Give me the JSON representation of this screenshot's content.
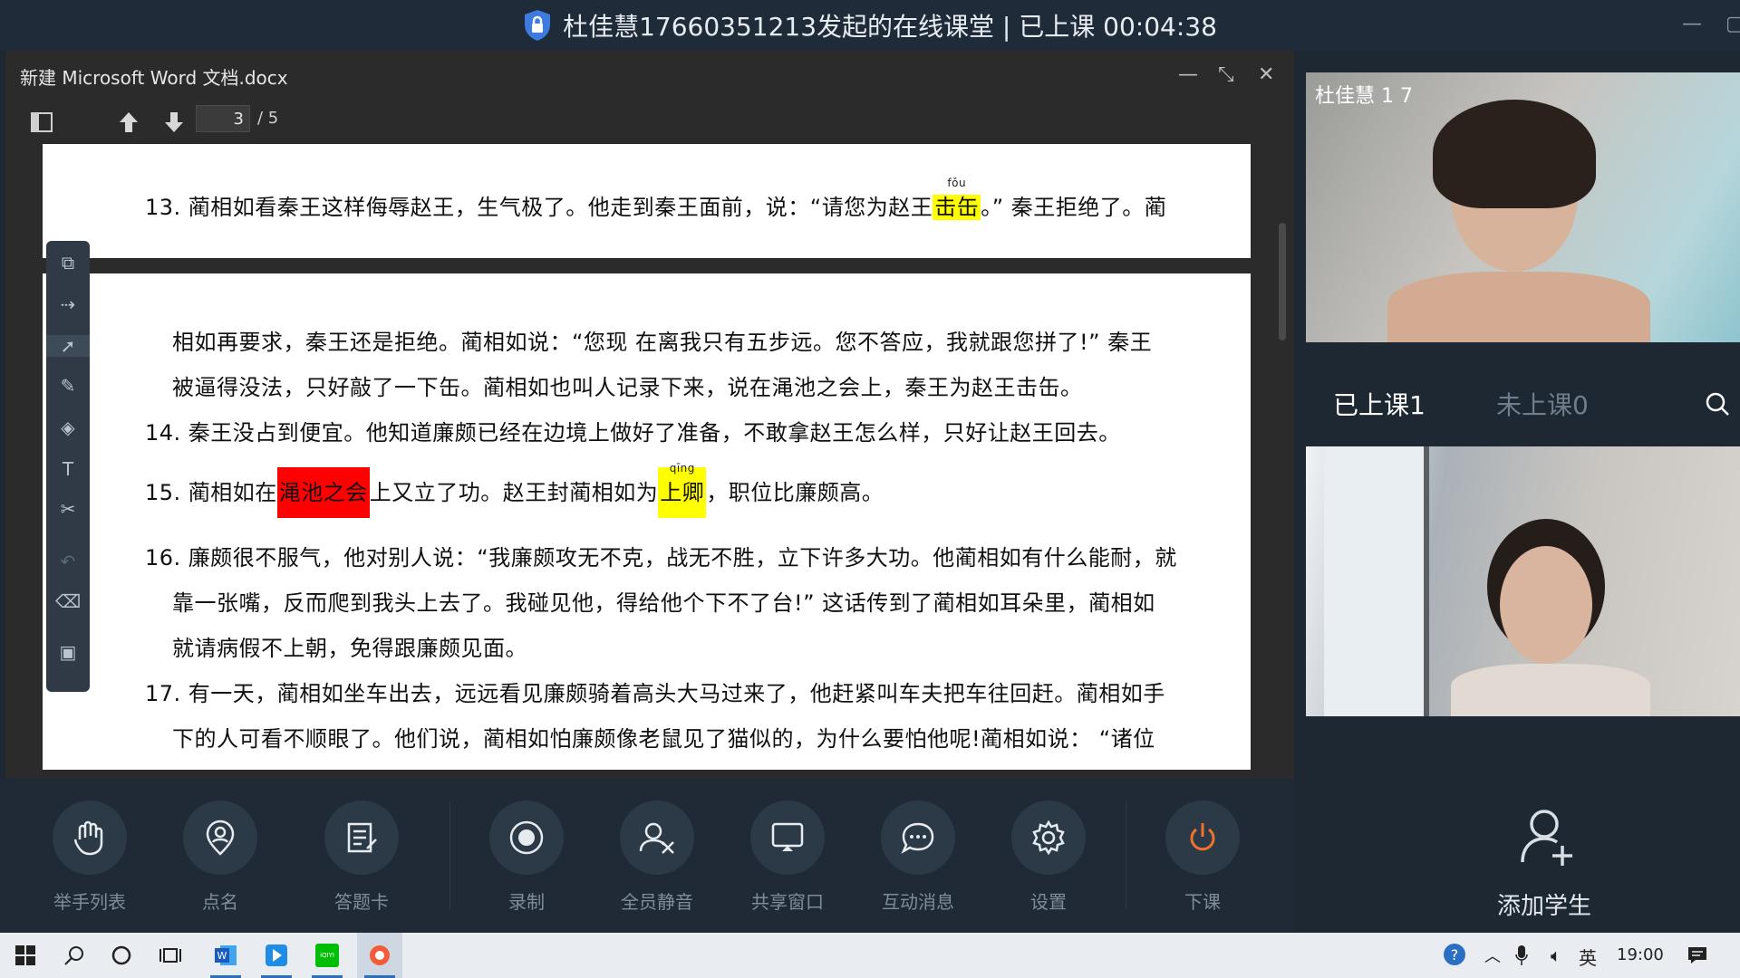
{
  "window": {
    "title": "杜佳慧17660351213发起的在线课堂 | 已上课 00:04:38"
  },
  "document": {
    "title": "新建 Microsoft Word 文档.docx",
    "page_current": "3",
    "page_total": "/ 5",
    "paragraphs": {
      "p13_line1": "13.  蔺相如看秦王这样侮辱赵王，生气极了。他走到秦王面前，说：“请您为赵王",
      "p13_hl": "击缶",
      "p13_ruby": "fǒu",
      "p13_tail": "。”  秦王拒绝了。蔺",
      "p13_line2": "相如再要求，秦王还是拒绝。蔺相如说：“您现  在离我只有五步远。您不答应，我就跟您拼了!”  秦王",
      "p13_line3": "被逼得没法，只好敲了一下缶。蔺相如也叫人记录下来，说在渑池之会上，秦王为赵王击缶。",
      "p14": "14.  秦王没占到便宜。他知道廉颇已经在边境上做好了准备，不敢拿赵王怎么样，只好让赵王回去。",
      "p15_pre": "15.  蔺相如在",
      "p15_red": "渑池之会",
      "p15_mid": "上又立了功。赵王封蔺相如为",
      "p15_hl": "上卿",
      "p15_ruby": "qīng",
      "p15_tail": "，职位比廉颇高。",
      "p16_line1": "16.  廉颇很不服气，他对别人说：“我廉颇攻无不克，战无不胜，立下许多大功。他蔺相如有什么能耐，就",
      "p16_line2": "靠一张嘴，反而爬到我头上去了。我碰见他，得给他个下不了台!”  这话传到了蔺相如耳朵里，蔺相如",
      "p16_line3": "就请病假不上朝，免得跟廉颇见面。",
      "p17_line1": "17.  有一天，蔺相如坐车出去，远远看见廉颇骑着高头大马过来了，他赶紧叫车夫把车往回赶。蔺相如手",
      "p17_line2": "下的人可看不顺眼了。他们说，蔺相如怕廉颇像老鼠见了猫似的，为什么要怕他呢!蔺相如说：  “诸位"
    }
  },
  "participants": {
    "teacher_name": "杜佳慧 1 7",
    "tab_attended": "已上课1",
    "tab_absent": "未上课0",
    "add_student": "添加学生"
  },
  "toolbar": {
    "raise_hand": "举手列表",
    "roll_call": "点名",
    "answer_card": "答题卡",
    "record": "录制",
    "mute_all": "全员静音",
    "share_window": "共享窗口",
    "messages": "互动消息",
    "settings": "设置",
    "end_class": "下课"
  },
  "taskbar": {
    "input_lang": "英",
    "time": "19:00",
    "iqiyi": "iQIYI"
  },
  "colors": {
    "highlight_yellow": "#ffff00",
    "highlight_red": "#ff0000",
    "end_class_orange": "#f0722a"
  }
}
